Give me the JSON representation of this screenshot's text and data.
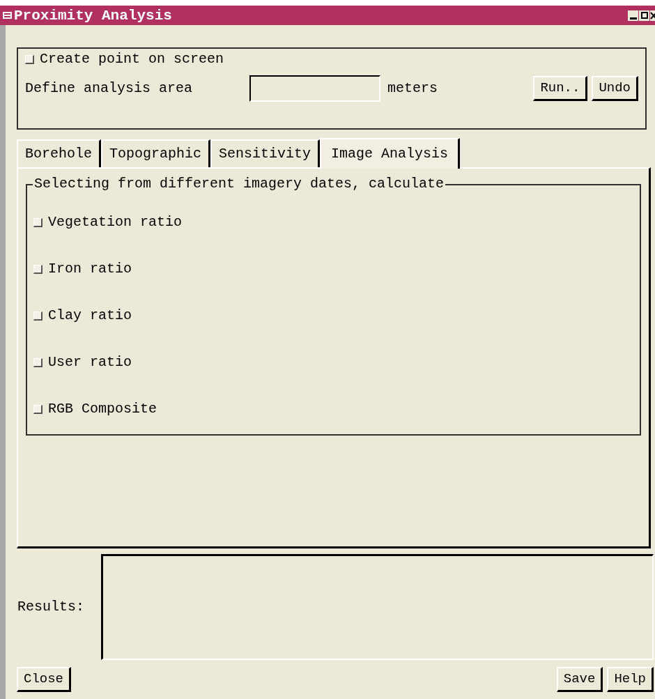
{
  "window": {
    "title": "Proximity Analysis"
  },
  "top": {
    "create_point": {
      "label": "Create point on screen",
      "checked": false
    },
    "area_label": "Define analysis area",
    "area_unit": "meters",
    "buttons": [
      "Run..",
      "Undo"
    ]
  },
  "tabs": [
    {
      "label": "Borehole",
      "selected": false
    },
    {
      "label": "Topographic",
      "selected": false
    },
    {
      "label": "Sensitivity",
      "selected": false
    },
    {
      "label": "Image Analysis",
      "selected": true
    }
  ],
  "group": {
    "title": "Selecting from different imagery dates, calculate",
    "options": [
      {
        "label": "Vegetation ratio",
        "checked": false
      },
      {
        "label": "Iron ratio",
        "checked": false
      },
      {
        "label": "Clay ratio",
        "checked": false
      },
      {
        "label": "User ratio",
        "checked": false
      },
      {
        "label": "RGB Composite",
        "checked": false
      }
    ]
  },
  "results": {
    "label": "Results:"
  },
  "footer": {
    "left": [
      "Close"
    ],
    "right": [
      "Save",
      "Help"
    ]
  }
}
